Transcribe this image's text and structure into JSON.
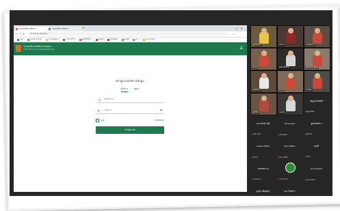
{
  "browser": {
    "tabs": [
      "ระบบบริหารจัดการ",
      "ระบบบริหารจัดการ"
    ],
    "url": "hr.rsd.go.th/login",
    "bookmarks": [
      "แอป",
      "ระบบสารบรรณ",
      "ระบบบุคลากร",
      "กรมการข้าว",
      "ศูนย์วิจัยข้าว",
      "Gmail",
      "YouTube",
      "แผนที่",
      "ข่าว",
      "ระบบประชุม"
    ]
  },
  "site": {
    "name": "ระบบบริหารทรัพยากรบุคคล",
    "subtitle": "กรมการข้าว กระทรวงเกษตรและสหกรณ์"
  },
  "login": {
    "title": "เข้าสู่ระบบบริหารข้อมูล",
    "tabs": [
      "ผู้ใช้งาน",
      "ผู้ดูแล"
    ],
    "username_value": "ชื่อผู้ใช้งาน",
    "password_value": "รหัสผ่าน",
    "remember_label": "จดจำ",
    "forgot_label": "ลืมรหัสผ่าน",
    "submit_label": "เข้าสู่ระบบ"
  },
  "meeting": {
    "video_tiles": [
      {
        "name": "ศูนย์วิจัยข้าว",
        "bg": "#6b5a3e",
        "shirt": "#e8c64a"
      },
      {
        "name": "สมชาย",
        "bg": "#4a3a33",
        "shirt": "#8a2a2a"
      },
      {
        "name": "กองแผนงาน",
        "bg": "#5a4e44",
        "shirt": "#c94a3b"
      },
      {
        "name": "สุภาพร",
        "bg": "#7a5e4c",
        "shirt": "#c94a3b"
      },
      {
        "name": "ศูนย์เมล็ดพันธุ์",
        "bg": "#2e2a28",
        "shirt": "#d3d3d3"
      },
      {
        "name": "กองการเจ้าหน้าที่",
        "bg": "#8a7a6a",
        "shirt": "#c94a3b"
      },
      {
        "name": "ศูนย์วิจัยข้าว",
        "bg": "#5c4a3a",
        "shirt": "#e8e8e8"
      },
      {
        "name": "วิภาวดี",
        "bg": "#7e6a58",
        "shirt": "#c94a3b"
      },
      {
        "name": "ประยุทธ",
        "bg": "#4e4a46",
        "shirt": "#c94a3b"
      },
      {
        "name": "ศูนย์วิจัย",
        "bg": "#6a5444",
        "shirt": "#b34a3b"
      },
      {
        "name": "กองคลัง",
        "bg": "#3a3633",
        "shirt": "#d8d8d8"
      }
    ],
    "participant_tiles": [
      {
        "label": "ณัฐวุฒิ ทิพยศรี",
        "sub": "ณัฐวุฒิ ทิพย"
      },
      {
        "label": "นายวสันต์ วันดี",
        "sub": "วสันต์ วันดี"
      },
      {
        "label": "Rice Dept",
        "sub": "Rice Dept"
      },
      {
        "label": "ศูนย์วิจัยข้าว",
        "sub": "ศูนย์วิจัย"
      },
      {
        "label": "Admin Office",
        "sub": "Admin"
      },
      {
        "label": "Ricx Office",
        "sub": "Ricx Office"
      },
      {
        "label": "สมศรี",
        "sub": "สมศรี"
      },
      {
        "label": "กองแผนงาน",
        "sub": "กองแผนงาน"
      },
      {
        "label": "Accountant",
        "sub": "Accountant"
      },
      {
        "label": "ศูนย์ เมล็ดพันธุ์",
        "sub": "ศูนย์ เมล็ด"
      },
      {
        "label": "กอง วิจัยข้าว",
        "sub": "กอง วิจัย"
      }
    ],
    "logo_tile_label": "กรมการข้าว"
  }
}
